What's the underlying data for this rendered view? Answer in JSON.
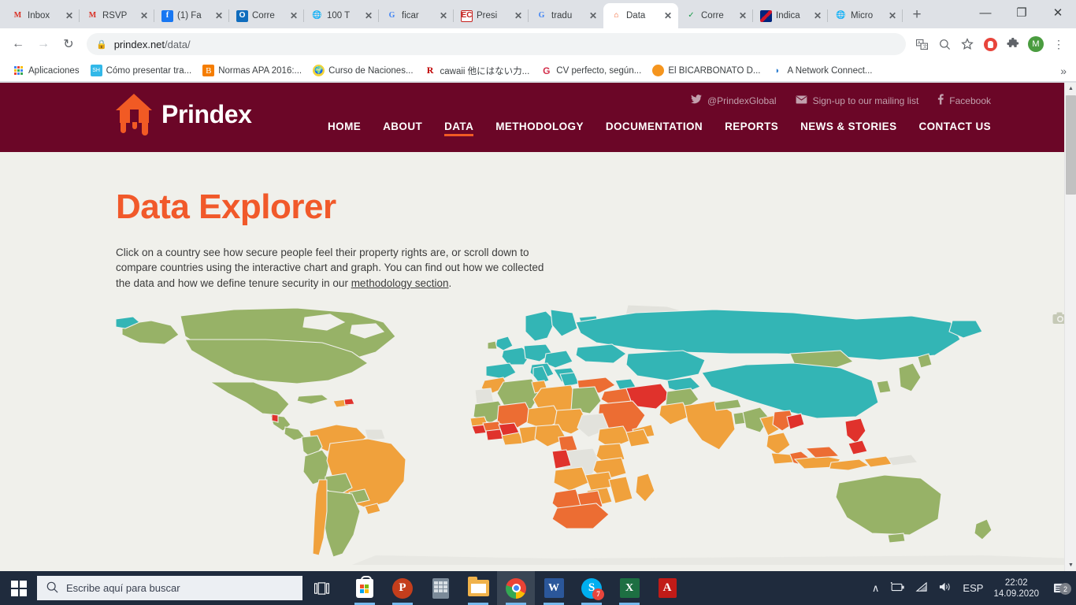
{
  "browser": {
    "tabs": [
      {
        "title": "Inbox",
        "icon": "gmail-icon",
        "active": false
      },
      {
        "title": "RSVP",
        "icon": "gmail-icon",
        "active": false
      },
      {
        "title": "(1) Fa",
        "icon": "facebook-icon",
        "active": false
      },
      {
        "title": "Corre",
        "icon": "outlook-icon",
        "active": false
      },
      {
        "title": "100 T",
        "icon": "globe-icon",
        "active": false
      },
      {
        "title": "ficar",
        "icon": "google-icon",
        "active": false
      },
      {
        "title": "Presi",
        "icon": "ec-icon",
        "active": false
      },
      {
        "title": "tradu",
        "icon": "google-icon",
        "active": false
      },
      {
        "title": "Data",
        "icon": "prindex-house-icon",
        "active": true
      },
      {
        "title": "Corre",
        "icon": "spellcheck-icon",
        "active": false
      },
      {
        "title": "Indica",
        "icon": "uk-flag-icon",
        "active": false
      },
      {
        "title": "Micro",
        "icon": "ms-globe-icon",
        "active": false
      }
    ],
    "new_tab_label": "+",
    "window_controls": {
      "minimize": "—",
      "maximize": "❐",
      "close": "✕"
    },
    "nav": {
      "back": "←",
      "forward": "→",
      "reload": "↻"
    },
    "omnibox": {
      "lock": "🔒",
      "host": "prindex.net",
      "path": "/data/"
    },
    "toolbar_icons": [
      {
        "name": "translate-icon",
        "glyph": "文"
      },
      {
        "name": "zoom-search-icon",
        "glyph": "⚲"
      },
      {
        "name": "bookmark-star-icon",
        "glyph": "☆"
      },
      {
        "name": "opera-extension-icon",
        "glyph": ""
      },
      {
        "name": "extensions-puzzle-icon",
        "glyph": "🧩"
      },
      {
        "name": "profile-avatar",
        "glyph": "M"
      },
      {
        "name": "chrome-menu-icon",
        "glyph": "⋮"
      }
    ],
    "bookmarks": [
      {
        "label": "Aplicaciones",
        "icon": "apps-grid-icon"
      },
      {
        "label": "Cómo presentar tra...",
        "icon": "slideshare-icon"
      },
      {
        "label": "Normas APA 2016:...",
        "icon": "blogger-icon"
      },
      {
        "label": "Curso de Naciones...",
        "icon": "un-globe-icon"
      },
      {
        "label": "cawaii 他にはない力...",
        "icon": "rakuten-icon"
      },
      {
        "label": "CV perfecto, según...",
        "icon": "cv-icon"
      },
      {
        "label": "El BICARBONATO D...",
        "icon": "orange-drop-icon"
      },
      {
        "label": "A Network Connect...",
        "icon": "pulse-icon"
      }
    ],
    "bookmarks_overflow": "»"
  },
  "site": {
    "brand": "Prindex",
    "social": [
      {
        "label": "@PrindexGlobal",
        "icon": "twitter-icon"
      },
      {
        "label": "Sign-up to our mailing list",
        "icon": "envelope-icon"
      },
      {
        "label": "Facebook",
        "icon": "facebook-f-icon"
      }
    ],
    "nav": [
      {
        "label": "HOME",
        "active": false
      },
      {
        "label": "ABOUT",
        "active": false
      },
      {
        "label": "DATA",
        "active": true
      },
      {
        "label": "METHODOLOGY",
        "active": false
      },
      {
        "label": "DOCUMENTATION",
        "active": false
      },
      {
        "label": "REPORTS",
        "active": false
      },
      {
        "label": "NEWS & STORIES",
        "active": false
      },
      {
        "label": "CONTACT US",
        "active": false
      }
    ],
    "page": {
      "title": "Data Explorer",
      "intro_part1": "Click on a country see how secure people feel their property rights are, or scroll down to compare countries using the interactive chart and graph. You can find out how we collected the data and how we define tenure security in our ",
      "intro_link": "methodology section",
      "intro_part2": ".",
      "camera_button": "download-map-camera-icon"
    },
    "colors": {
      "header_maroon": "#6B0627",
      "accent_orange": "#F1592A",
      "page_bg": "#F0F0EB",
      "map_green": "#97B267",
      "map_teal": "#33B5B5",
      "map_orange": "#F0A13C",
      "map_dark_orange": "#EC6D33",
      "map_red": "#E0322C",
      "map_nodata": "#E2E2DC",
      "map_ocean": "#F0F0EB"
    }
  },
  "taskbar": {
    "start": "windows-start-icon",
    "search_placeholder": "Escribe aquí para buscar",
    "task_view": "task-view-icon",
    "apps": [
      {
        "name": "microsoft-store",
        "running": true
      },
      {
        "name": "powerpoint",
        "running": true
      },
      {
        "name": "calculator",
        "running": false
      },
      {
        "name": "file-explorer",
        "running": true
      },
      {
        "name": "google-chrome",
        "running": true,
        "active": true
      },
      {
        "name": "word",
        "running": true
      },
      {
        "name": "skype",
        "running": true,
        "badge": "7"
      },
      {
        "name": "excel",
        "running": true
      },
      {
        "name": "adobe-acrobat",
        "running": false
      }
    ],
    "tray": {
      "chevron": "∧",
      "battery": "battery-icon",
      "wifi": "wifi-icon",
      "volume": "volume-icon",
      "language": "ESP",
      "time": "22:02",
      "date": "14.09.2020",
      "notifications_badge": "2"
    }
  }
}
